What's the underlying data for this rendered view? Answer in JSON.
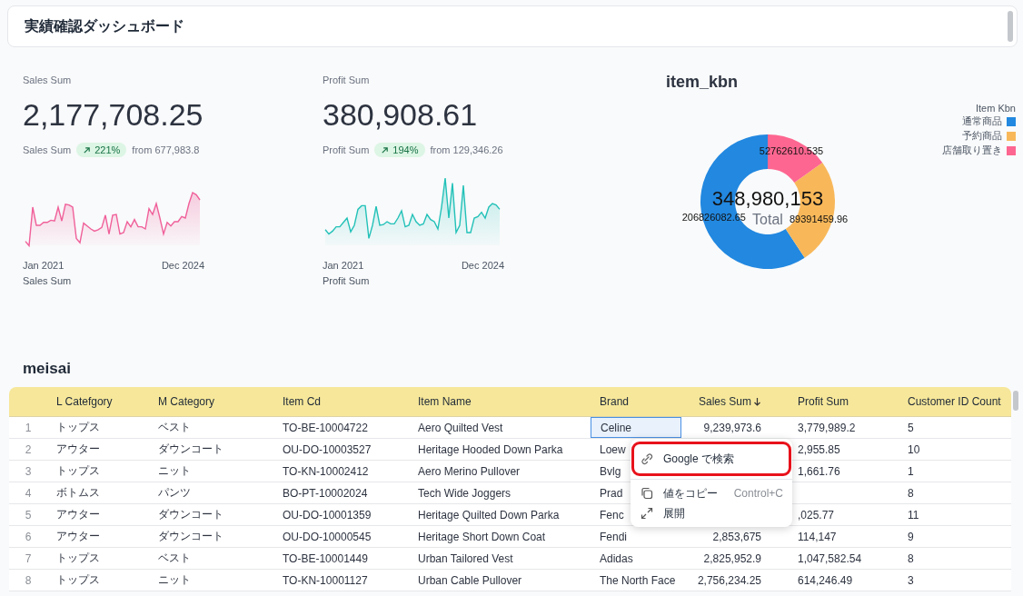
{
  "header": {
    "title": "実績確認ダッシュボード"
  },
  "kpis": [
    {
      "label": "Sales Sum",
      "value": "2,177,708.25",
      "compare_label": "Sales Sum",
      "change": "221%",
      "from": "from 677,983.8",
      "color": "#f0609a",
      "x_start": "Jan 2021",
      "x_end": "Dec 2024",
      "footer": "Sales Sum"
    },
    {
      "label": "Profit Sum",
      "value": "380,908.61",
      "compare_label": "Profit Sum",
      "change": "194%",
      "from": "from 129,346.26",
      "color": "#22c1b8",
      "x_start": "Jan 2021",
      "x_end": "Dec 2024",
      "footer": "Profit Sum"
    }
  ],
  "donut": {
    "title": "item_kbn",
    "center_value": "348,980,153",
    "center_label": "Total",
    "chart_data": {
      "type": "donut",
      "categories": [
        "通常商品",
        "予約商品",
        "店舗取り置き"
      ],
      "series": [
        {
          "name": "Item Kbn",
          "colors": [
            "#2288e0",
            "#f8b85a",
            "#fd6690"
          ],
          "values": [
            206826082.65,
            89391459.96,
            52762610.535
          ]
        }
      ],
      "data_labels": true
    }
  },
  "table": {
    "title": "meisai",
    "columns": [
      {
        "label": "L Catefgory",
        "sorted": false
      },
      {
        "label": "M Category",
        "sorted": false
      },
      {
        "label": "Item Cd",
        "sorted": false
      },
      {
        "label": "Item Name",
        "sorted": false
      },
      {
        "label": "Brand",
        "sorted": false
      },
      {
        "label": "Sales Sum",
        "sorted": true
      },
      {
        "label": "Profit Sum",
        "sorted": false
      },
      {
        "label": "Customer ID Count",
        "sorted": false
      }
    ],
    "rows": [
      {
        "number": "1",
        "cells": [
          {
            "text": "トップス",
            "selected": false
          },
          {
            "text": "ベスト",
            "selected": false
          },
          {
            "text": "TO-BE-10004722",
            "selected": false
          },
          {
            "text": "Aero Quilted Vest",
            "selected": false
          },
          {
            "text": "Celine",
            "selected": true
          },
          {
            "text": "9,239,973.6",
            "selected": false
          },
          {
            "text": "3,779,989.2",
            "selected": false
          },
          {
            "text": "5",
            "selected": false
          }
        ]
      },
      {
        "number": "2",
        "cells": [
          {
            "text": "アウター",
            "selected": false
          },
          {
            "text": "ダウンコート",
            "selected": false
          },
          {
            "text": "OU-DO-10003527",
            "selected": false
          },
          {
            "text": "Heritage Hooded Down Parka",
            "selected": false
          },
          {
            "text": "Loew",
            "selected": false
          },
          null,
          {
            "text": "2,955.85",
            "selected": false
          },
          {
            "text": "10",
            "selected": false
          }
        ]
      },
      {
        "number": "3",
        "cells": [
          {
            "text": "トップス",
            "selected": false
          },
          {
            "text": "ニット",
            "selected": false
          },
          {
            "text": "TO-KN-10002412",
            "selected": false
          },
          {
            "text": "Aero Merino Pullover",
            "selected": false
          },
          {
            "text": "Bvlg",
            "selected": false
          },
          null,
          {
            "text": "1,661.76",
            "selected": false
          },
          {
            "text": "1",
            "selected": false
          }
        ]
      },
      {
        "number": "4",
        "cells": [
          {
            "text": "ボトムス",
            "selected": false
          },
          {
            "text": "パンツ",
            "selected": false
          },
          {
            "text": "BO-PT-10002024",
            "selected": false
          },
          {
            "text": "Tech Wide Joggers",
            "selected": false
          },
          {
            "text": "Prad",
            "selected": false
          },
          null,
          null,
          {
            "text": "8",
            "selected": false
          }
        ]
      },
      {
        "number": "5",
        "cells": [
          {
            "text": "アウター",
            "selected": false
          },
          {
            "text": "ダウンコート",
            "selected": false
          },
          {
            "text": "OU-DO-10001359",
            "selected": false
          },
          {
            "text": "Heritage Quilted Down Parka",
            "selected": false
          },
          {
            "text": "Fenc",
            "selected": false
          },
          null,
          {
            "text": ",025.77",
            "selected": false
          },
          {
            "text": "11",
            "selected": false
          }
        ]
      },
      {
        "number": "6",
        "cells": [
          {
            "text": "アウター",
            "selected": false
          },
          {
            "text": "ダウンコート",
            "selected": false
          },
          {
            "text": "OU-DO-10000545",
            "selected": false
          },
          {
            "text": "Heritage Short Down Coat",
            "selected": false
          },
          {
            "text": "Fendi",
            "selected": false
          },
          {
            "text": "2,853,675",
            "selected": false
          },
          {
            "text": "114,147",
            "selected": false
          },
          {
            "text": "9",
            "selected": false
          }
        ]
      },
      {
        "number": "7",
        "cells": [
          {
            "text": "トップス",
            "selected": false
          },
          {
            "text": "ベスト",
            "selected": false
          },
          {
            "text": "TO-BE-10001449",
            "selected": false
          },
          {
            "text": "Urban Tailored Vest",
            "selected": false
          },
          {
            "text": "Adidas",
            "selected": false
          },
          {
            "text": "2,825,952.9",
            "selected": false
          },
          {
            "text": "1,047,582.54",
            "selected": false
          },
          {
            "text": "8",
            "selected": false
          }
        ]
      },
      {
        "number": "8",
        "cells": [
          {
            "text": "トップス",
            "selected": false
          },
          {
            "text": "ニット",
            "selected": false
          },
          {
            "text": "TO-KN-10001127",
            "selected": false
          },
          {
            "text": "Urban Cable Pullover",
            "selected": false
          },
          {
            "text": "The North Face",
            "selected": false
          },
          {
            "text": "2,756,234.25",
            "selected": false
          },
          {
            "text": "614,246.49",
            "selected": false
          },
          {
            "text": "3",
            "selected": false
          }
        ]
      }
    ]
  },
  "context_menu": {
    "items": [
      {
        "label": "Google で検索",
        "highlighted": true
      },
      {
        "label": "値をコピー",
        "shortcut": "Control+C",
        "highlighted": false
      },
      {
        "label": "展開",
        "highlighted": false
      }
    ]
  }
}
